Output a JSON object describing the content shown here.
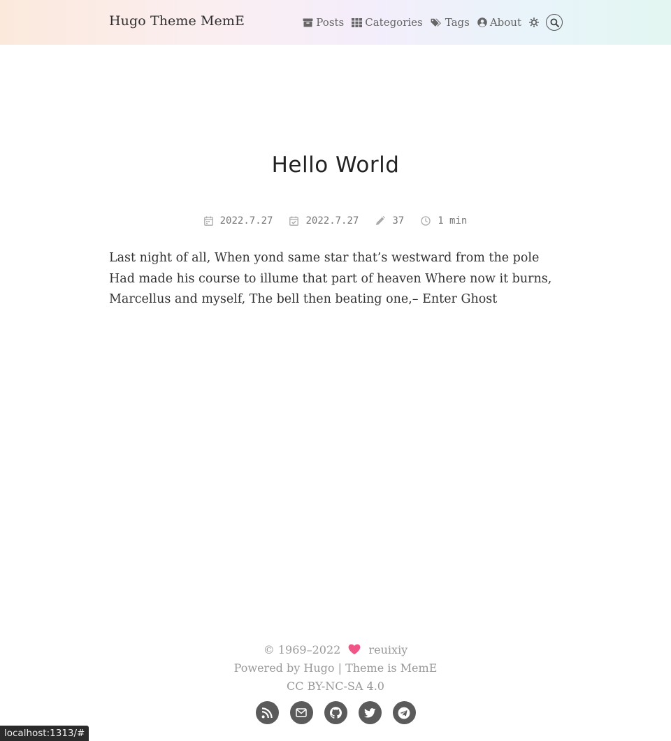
{
  "header": {
    "site_title": "Hugo Theme MemE",
    "nav": [
      {
        "label": "Posts",
        "icon": "archive-icon"
      },
      {
        "label": "Categories",
        "icon": "grid-icon"
      },
      {
        "label": "Tags",
        "icon": "tags-icon"
      },
      {
        "label": "About",
        "icon": "user-circle-icon"
      }
    ],
    "theme_toggle_icon": "sun-icon",
    "search_icon": "search-icon"
  },
  "post": {
    "title": "Hello World",
    "meta": {
      "published": "2022.7.27",
      "updated": "2022.7.27",
      "word_count": "37",
      "reading_time": "1 min"
    },
    "body": "Last night of all, When yond same star that’s westward from the pole Had made his course to illume that part of heaven Where now it burns, Marcellus and myself, The bell then beating one,– Enter Ghost"
  },
  "footer": {
    "copyright": "© 1969–2022",
    "author": "reuixiy",
    "powered_prefix": "Powered by",
    "powered_link": "Hugo",
    "separator": "|",
    "theme_prefix": "Theme is",
    "theme_link": "MemE",
    "license": "CC BY-NC-SA 4.0",
    "heart_color": "#ef5587",
    "social": [
      "rss-icon",
      "mail-icon",
      "github-icon",
      "twitter-icon",
      "telegram-icon"
    ]
  },
  "status_bar": {
    "url": "localhost:1313/#"
  }
}
